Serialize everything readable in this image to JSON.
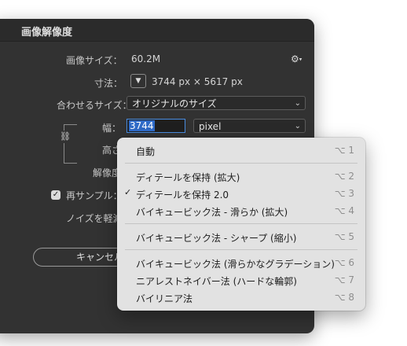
{
  "dialog": {
    "title": "画像解像度",
    "image_size_label": "画像サイズ：",
    "image_size_value": "60.2M",
    "gear_icon": "gear-icon",
    "dimensions_label": "寸法：",
    "dimensions_value": "3744 px × 5617 px",
    "fit_to_label": "合わせるサイズ：",
    "fit_to_value": "オリジナルのサイズ",
    "width_label": "幅：",
    "width_value": "3744",
    "width_unit": "pixel",
    "height_label": "高さ",
    "resolution_label": "解像度",
    "resample_label": "再サンプル：",
    "resample_checked": true,
    "noise_label": "ノイズを軽減",
    "cancel_label": "キャンセル"
  },
  "menu": {
    "items": [
      {
        "label": "自動",
        "shortcut": "⌥ 1",
        "checked": false
      },
      {
        "label": "ディテールを保持 (拡大)",
        "shortcut": "⌥ 2",
        "checked": false
      },
      {
        "label": "ディテールを保持 2.0",
        "shortcut": "⌥ 3",
        "checked": true
      },
      {
        "label": "バイキュービック法 - 滑らか (拡大)",
        "shortcut": "⌥ 4",
        "checked": false
      },
      {
        "label": "バイキュービック法 - シャープ (縮小)",
        "shortcut": "⌥ 5",
        "checked": false
      },
      {
        "label": "バイキュービック法 (滑らかなグラデーション)",
        "shortcut": "⌥ 6",
        "checked": false
      },
      {
        "label": "ニアレストネイバー法 (ハードな輪郭)",
        "shortcut": "⌥ 7",
        "checked": false
      },
      {
        "label": "バイリニア法",
        "shortcut": "⌥ 8",
        "checked": false
      }
    ],
    "check_mark": "✓"
  },
  "colors": {
    "dialog_bg": "#323232",
    "menu_bg": "#e2e2e2",
    "selection": "#2f6bc8",
    "focus_ring": "#4a8de0"
  }
}
